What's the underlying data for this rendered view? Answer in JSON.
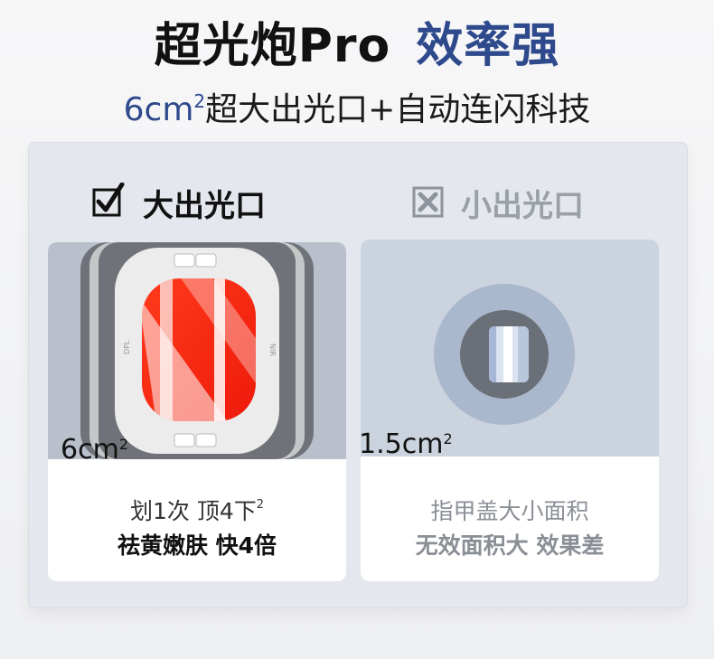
{
  "header": {
    "title_main": "超光炮Pro",
    "title_accent": "效率强",
    "subtitle_num": "6cm",
    "subtitle_sup": "2",
    "subtitle_rest": "超大出光口+自动连闪科技"
  },
  "comparison": {
    "left": {
      "heading": "大出光口",
      "area_value": "6cm",
      "area_sup": "2",
      "caption_line1": "划1次 顶4下",
      "caption_sup": "2",
      "caption_line2": "祛黄嫩肤 快4倍",
      "device_label_left": "DPL",
      "device_label_right": "NIR",
      "check_icon": "checkbox-checked-icon"
    },
    "right": {
      "heading": "小出光口",
      "area_value": "1.5cm",
      "area_sup": "2",
      "caption_line1": "指甲盖大小面积",
      "caption_line2": "无效面积大 效果差",
      "cross_icon": "checkbox-crossed-icon"
    }
  },
  "colors": {
    "accent_blue": "#2e4a8c",
    "light_red": "#ff2a10",
    "muted_gray": "#9aa0a8"
  }
}
